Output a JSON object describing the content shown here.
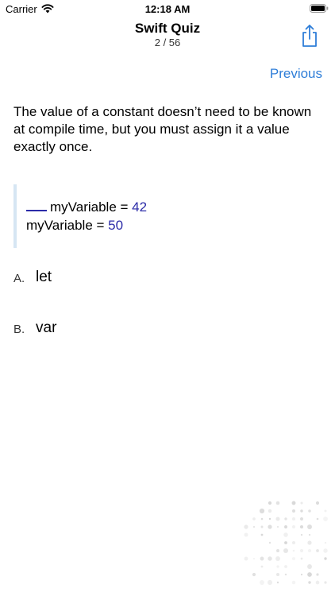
{
  "status_bar": {
    "carrier": "Carrier",
    "time": "12:18 AM",
    "wifi_icon": "wifi-icon",
    "battery_icon": "battery-full-icon"
  },
  "nav": {
    "title": "Swift Quiz",
    "subtitle": "2 / 56",
    "share_icon": "share-icon"
  },
  "toolbar": {
    "previous_label": "Previous"
  },
  "question": {
    "text": "The value of a constant doesn’t need to be known at compile time, but you must assign it a value exactly once."
  },
  "code": {
    "line1_name": "myVariable = ",
    "line1_value": "42",
    "line2_name": "myVariable = ",
    "line2_value": "50"
  },
  "answers": [
    {
      "letter": "A.",
      "text": "let"
    },
    {
      "letter": "B.",
      "text": "var"
    }
  ],
  "colors": {
    "accent": "#2f7ed8",
    "code_number": "#2b2ba8",
    "code_bar": "#d6e6f3"
  }
}
